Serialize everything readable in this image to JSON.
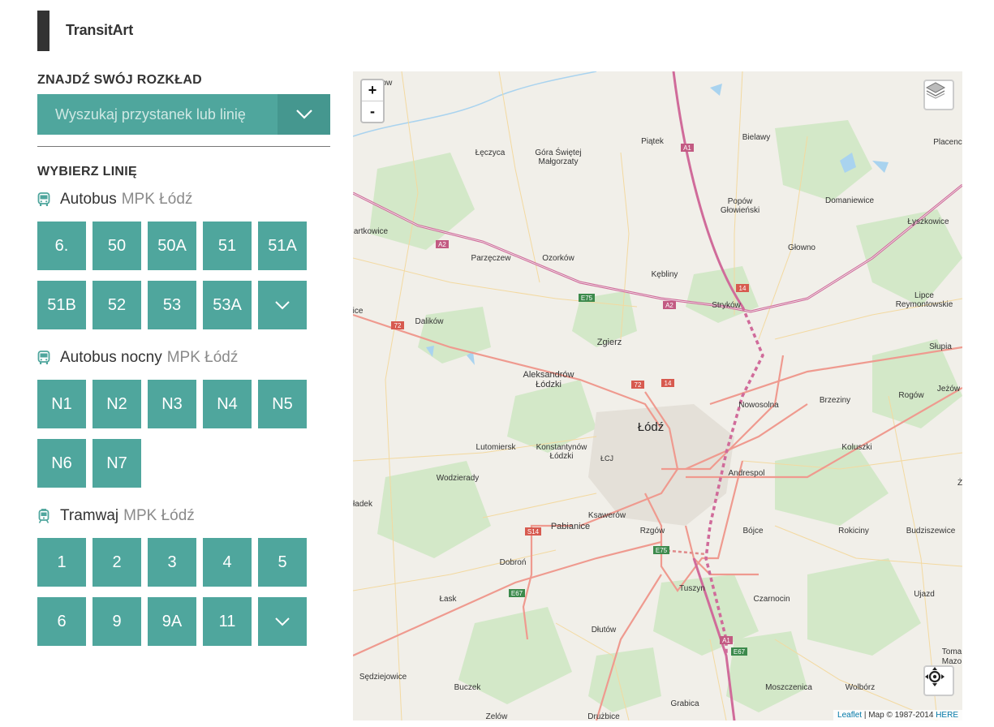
{
  "app": {
    "title": "TransitArt"
  },
  "search": {
    "section_title": "ZNAJDŹ SWÓJ ROZKŁAD",
    "placeholder": "Wyszukaj przystanek lub linię"
  },
  "lines_title": "WYBIERZ LINIĘ",
  "groups": [
    {
      "type": "Autobus",
      "operator": "MPK Łódź",
      "icon": "bus-icon",
      "lines": [
        "6.",
        "50",
        "50A",
        "51",
        "51A",
        "51B",
        "52",
        "53",
        "53A"
      ],
      "has_more": true
    },
    {
      "type": "Autobus nocny",
      "operator": "MPK Łódź",
      "icon": "bus-icon",
      "lines": [
        "N1",
        "N2",
        "N3",
        "N4",
        "N5",
        "N6",
        "N7"
      ],
      "has_more": false
    },
    {
      "type": "Tramwaj",
      "operator": "MPK Łódź",
      "icon": "tram-icon",
      "lines": [
        "1",
        "2",
        "3",
        "4",
        "5",
        "6",
        "9",
        "9A",
        "11"
      ],
      "has_more": true
    }
  ],
  "map": {
    "zoom_in": "+",
    "zoom_out": "-",
    "attribution_link": "Leaflet",
    "attribution_text": " | Map © 1987-2014 ",
    "attribution_here": "HERE",
    "labels": {
      "lodz": "Łódź",
      "zgierz": "Zgierz",
      "aleksandrow1": "Aleksandrów",
      "aleksandrow2": "Łódzki",
      "konst1": "Konstantynów",
      "konst2": "Łódzki",
      "pabianice": "Pabianice",
      "ksawerow": "Ksawerów",
      "lutomiersk": "Lutomiersk",
      "wodzierady": "Wodzierady",
      "dalikow": "Dalików",
      "parzeczew": "Parzęczew",
      "ozorkow": "Ozorków",
      "leczyca": "Łęczyca",
      "gora1": "Góra Świętej",
      "gora2": "Małgorzaty",
      "piatek": "Piątek",
      "bielawy": "Bielawy",
      "popow1": "Popów",
      "popow2": "Głowieński",
      "domaniewice": "Domaniewice",
      "lyszkowice": "Łyszkowice",
      "glowno": "Głowno",
      "kebliny": "Kębliny",
      "strykow": "Stryków",
      "lipce1": "Lipce",
      "lipce2": "Reymontowskie",
      "slupia": "Słupia",
      "nowosolna": "Nowosolna",
      "brzeziny": "Brzeziny",
      "rogow": "Rogów",
      "jezow": "Jeżów",
      "koluszki": "Koluszki",
      "andrespol": "Andrespol",
      "rzgow": "Rzgów",
      "brojce": "Bójce",
      "rokiciny": "Rokiciny",
      "budziszewice": "Budziszewice",
      "dobron": "Dobroń",
      "lask": "Łask",
      "tuszyn": "Tuszyn",
      "czarnocin": "Czarnocin",
      "ujazd": "Ujazd",
      "dlutow": "Dłutów",
      "sedziejowice": "Sędziejowice",
      "buczek": "Buczek",
      "grabica": "Grabica",
      "moszczenica": "Moszczenica",
      "wolborz": "Wolbórz",
      "zelow": "Zelów",
      "druzbice": "Drużbice",
      "placenc": "Placenc",
      "tomaz1": "Toma",
      "tomaz2": "Mazo",
      "artkowice": "artkowice",
      "adek": "ładek",
      "ice": "ice",
      "lcj": "ŁCJ",
      "zz": "Ż",
      "ow": "ow",
      "a1": "A1",
      "a2": "A2",
      "e75": "E75",
      "e67": "E67",
      "s14": "S14",
      "r14": "14",
      "r72": "72",
      "r14b": "14",
      "r72b": "72"
    }
  }
}
